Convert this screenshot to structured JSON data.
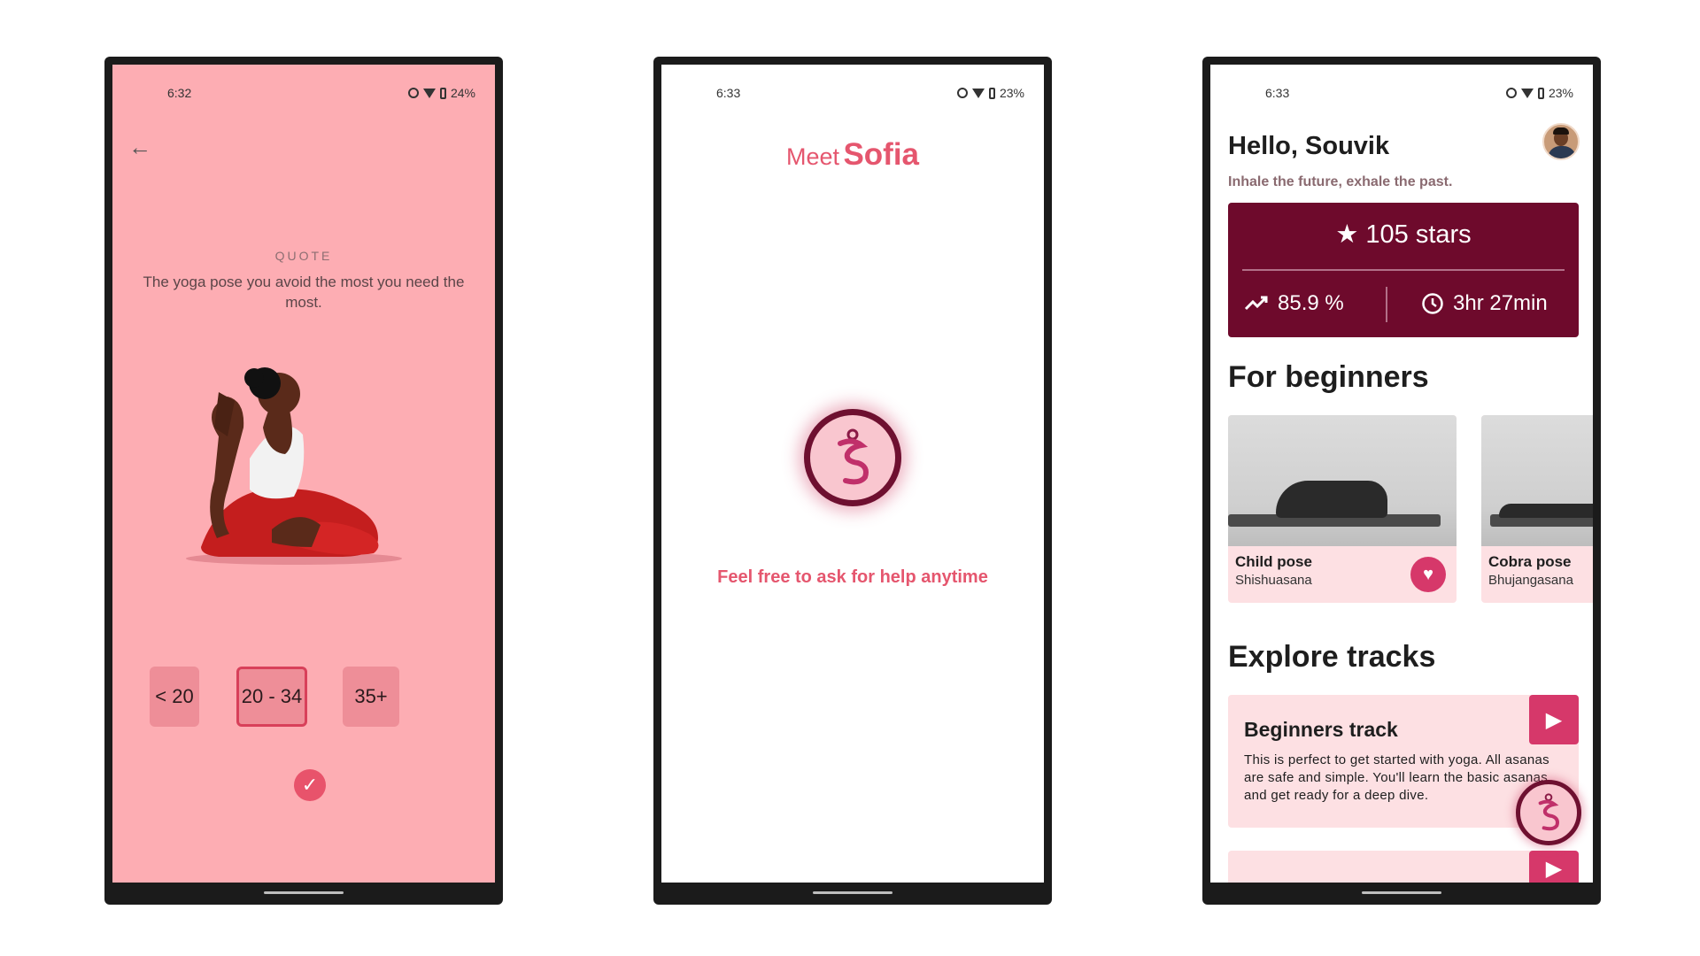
{
  "screens": [
    {
      "status": {
        "time": "6:32",
        "battery": "24%"
      },
      "quote_label": "QUOTE",
      "quote_text": "The yoga pose you avoid the most you need the most.",
      "age_options": [
        "< 20",
        "20 - 34",
        "35+"
      ],
      "selected_age": "20 - 34"
    },
    {
      "status": {
        "time": "6:33",
        "battery": "23%"
      },
      "meet": "Meet",
      "name": "Sofia",
      "help_text": "Feel free to ask for help anytime"
    },
    {
      "status": {
        "time": "6:33",
        "battery": "23%"
      },
      "greeting": "Hello, Souvik",
      "tagline": "Inhale the future, exhale the past.",
      "stats": {
        "stars": "105 stars",
        "percent": "85.9 %",
        "duration": "3hr 27min"
      },
      "beginners_title": "For beginners",
      "poses": [
        {
          "name": "Child pose",
          "sanskrit": "Shishuasana"
        },
        {
          "name": "Cobra pose",
          "sanskrit": "Bhujangasana"
        }
      ],
      "tracks_title": "Explore tracks",
      "tracks": [
        {
          "title": "Beginners track",
          "description": "This is perfect to get started with yoga. All asanas are safe and simple. You'll learn the basic asanas and get ready for a deep dive."
        }
      ]
    }
  ],
  "colors": {
    "brand": "#6e0a2c",
    "accent": "#e5566e",
    "pink_bg": "#fdadb3",
    "card_bg": "#fde0e3",
    "button": "#d6386a"
  }
}
